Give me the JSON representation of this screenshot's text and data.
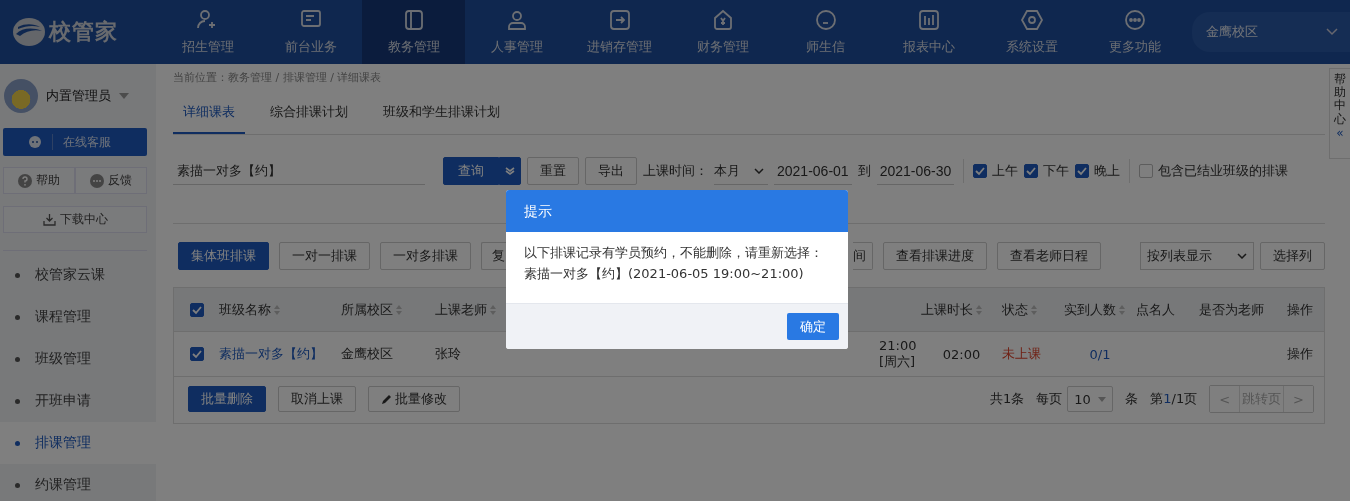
{
  "logo": {
    "text": "校管家"
  },
  "nav": [
    {
      "label": "招生管理",
      "selected": false
    },
    {
      "label": "前台业务",
      "selected": false
    },
    {
      "label": "教务管理",
      "selected": true
    },
    {
      "label": "人事管理",
      "selected": false
    },
    {
      "label": "进销存管理",
      "selected": false
    },
    {
      "label": "财务管理",
      "selected": false
    },
    {
      "label": "师生信",
      "selected": false
    },
    {
      "label": "报表中心",
      "selected": false
    },
    {
      "label": "系统设置",
      "selected": false
    },
    {
      "label": "更多功能",
      "selected": false
    }
  ],
  "campus_select": {
    "value": "金鹰校区"
  },
  "user": {
    "name": "内置管理员"
  },
  "sidebar_buttons": {
    "service": "在线客服",
    "help": "帮助",
    "feedback": "反馈",
    "download": "下载中心"
  },
  "sidebar": {
    "items": [
      {
        "label": "校管家云课",
        "selected": false
      },
      {
        "label": "课程管理",
        "selected": false
      },
      {
        "label": "班级管理",
        "selected": false
      },
      {
        "label": "开班申请",
        "selected": false
      },
      {
        "label": "排课管理",
        "selected": true
      },
      {
        "label": "约课管理",
        "selected": false
      }
    ]
  },
  "breadcrumb": "当前位置：教务管理 / 排课管理 / 详细课表",
  "tabs": [
    {
      "label": "详细课表",
      "selected": true
    },
    {
      "label": "综合排课计划",
      "selected": false
    },
    {
      "label": "班级和学生排课计划",
      "selected": false
    }
  ],
  "filters": {
    "search_value": "素描一对多【约】",
    "query": "查询",
    "reset": "重置",
    "export": "导出",
    "time_label": "上课时间：",
    "period": "本月",
    "date_from": "2021-06-01",
    "to": "到",
    "date_to": "2021-06-30",
    "checks": [
      {
        "label": "上午",
        "checked": true
      },
      {
        "label": "下午",
        "checked": true
      },
      {
        "label": "晚上",
        "checked": true
      },
      {
        "label": "包含已结业班级的排课",
        "checked": false
      }
    ]
  },
  "toolbar": {
    "left": [
      {
        "label": "集体班排课",
        "kind": "primary"
      },
      {
        "label": "一对一排课",
        "kind": "default"
      },
      {
        "label": "一对多排课",
        "kind": "default"
      },
      {
        "label": "复",
        "kind": "clipped-left"
      },
      {
        "label": "间",
        "kind": "clipped-right"
      },
      {
        "label": "查看排课进度",
        "kind": "default"
      },
      {
        "label": "查看老师日程",
        "kind": "default"
      }
    ],
    "view_select": "按列表显示",
    "choose_columns": "选择列"
  },
  "table": {
    "all_checked": true,
    "columns_left": [
      {
        "label": "班级名称",
        "sortable": true
      },
      {
        "label": "所属校区",
        "sortable": true
      },
      {
        "label": "上课老师",
        "sortable": true
      }
    ],
    "columns_right": [
      {
        "label": "上课时长",
        "sortable": true
      },
      {
        "label": "状态",
        "sortable": true
      },
      {
        "label": "实到人数",
        "sortable": true
      },
      {
        "label": "点名人",
        "sortable": false
      },
      {
        "label": "是否为老师",
        "sortable": false
      },
      {
        "label": "操作",
        "sortable": false
      }
    ],
    "rows": [
      {
        "checked": true,
        "class_name": "素描一对多【约】",
        "campus": "金鹰校区",
        "teacher": "张玲",
        "time": "21:00 [周六]",
        "duration": "02:00",
        "status": "未上课",
        "attendance": "0/1",
        "operation": "操作"
      }
    ]
  },
  "bulk": {
    "delete": "批量删除",
    "cancel": "取消上课",
    "edit": "批量修改"
  },
  "pagination": {
    "total": "共1条",
    "per_page_label": "每页",
    "per_page": "10",
    "unit": "条",
    "page_prefix": "第",
    "page_current": "1",
    "page_rest": "/1页",
    "prev": "<",
    "jump": "跳转页",
    "next": ">"
  },
  "help_tab": {
    "text": "帮助中心",
    "collapse": "«"
  },
  "dialog": {
    "title": "提示",
    "message": "以下排课记录有学员预约，不能删除，请重新选择：",
    "detail": "素描一对多【约】(2021-06-05 19:00~21:00)",
    "ok": "确定"
  }
}
